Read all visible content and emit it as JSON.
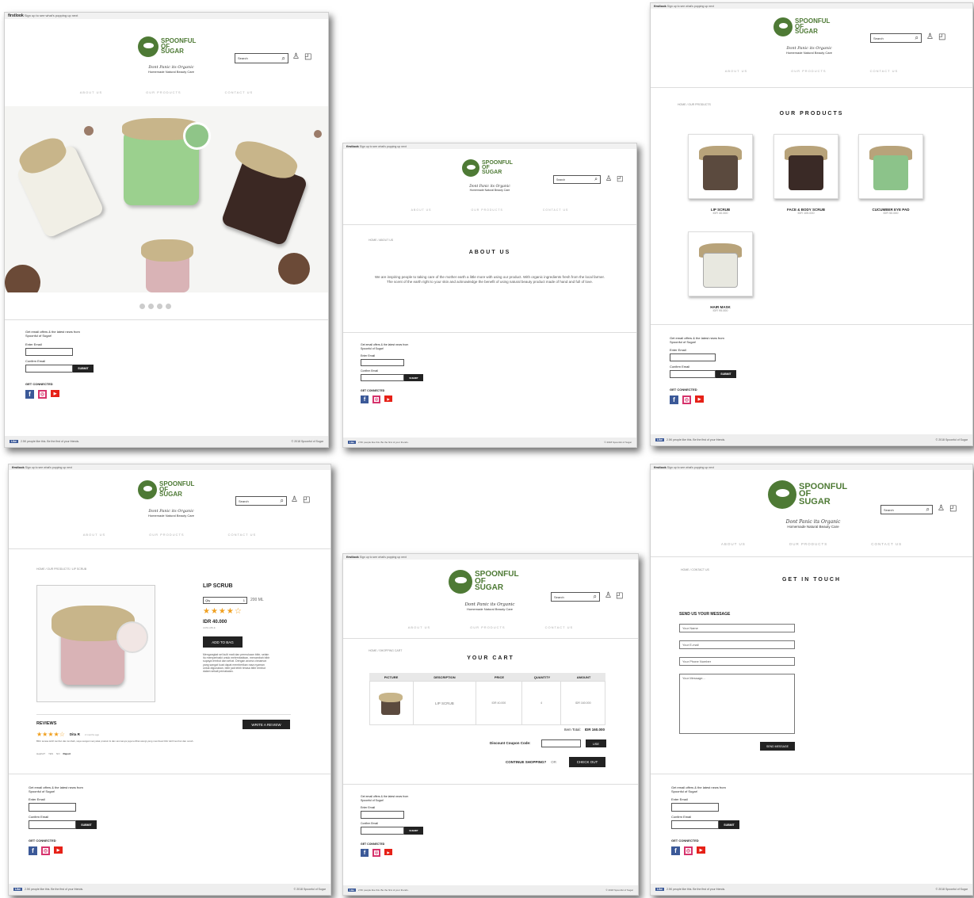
{
  "brand": {
    "name": [
      "SPOONFUL",
      "OF",
      "SUGAR"
    ],
    "slogan": "Dont Panic its Organic",
    "subtitle": "Homemade Natural Beauty Care",
    "color": "#4e7a35"
  },
  "topbar": {
    "brand": "firstlook",
    "text": "Sign up to see what's popping up next"
  },
  "search": {
    "placeholder": "Search"
  },
  "nav": {
    "about": "ABOUT US",
    "products": "OUR PRODUCTS",
    "contact": "CONTACT US"
  },
  "footer": {
    "offer": "Get email offers & the latest news from Spoonful of Sugar!",
    "enter_email": "Enter Email",
    "confirm_email": "Confirm Email",
    "submit": "SUBMIT",
    "connected": "GET CONNECTED",
    "like": "Like",
    "likes_text": "2.5K people like this. Be the first of your friends.",
    "copyright": "© 2018 Spoonful of Sugar"
  },
  "home": {
    "carousel_dots": 4
  },
  "about": {
    "crumb": "HOME / ABOUT US",
    "title": "ABOUT US",
    "body": "We are inspiring people to taking care of the mother earth a little more with using our product. With organic ingredients fresh from the local farmer. The scent of the earth right to your skin and acknowledge the benefit of using natural beauty product made of hand and full of love."
  },
  "products": {
    "crumb": "HOME / OUR PRODUCTS",
    "title": "OUR PRODUCTS",
    "items": [
      {
        "name": "LIP SCRUB",
        "price": "IDR 40.000",
        "color": "#5b4a3e"
      },
      {
        "name": "FACE & BODY SCRUB",
        "price": "IDR 105.000",
        "color": "#3a2a26"
      },
      {
        "name": "CUCUMBER EYE PAD",
        "price": "IDR 50.000",
        "color": "#8cc38a"
      },
      {
        "name": "HAIR MASK",
        "price": "IDR 95.000",
        "color": "#e8e8e0"
      }
    ]
  },
  "detail": {
    "crumb": "HOME / OUR PRODUCTS / LIP SCRUB",
    "name": "LIP SCRUB",
    "qty_label": "Qty",
    "qty": "1",
    "size": "200 ML",
    "rating": "★★★★☆",
    "price": "IDR 40.000",
    "stock": "AVAILABLE",
    "add": "ADD TO BAG",
    "desc": "Mengangkat sel kulit mati dan permukaan bibir, selain itu memperbaiki untuk melembabkan, menambah bibir supaya lembut dan sehat. Dengan aroma cinnamon yang sangat kuat dapat memberikan rasa nyaman untuk digunakan, bibir jadi lebih terasa bibir lembut dalam sekali pemakaian.",
    "reviews": "REVIEWS",
    "write": "WRITE A REVIEW",
    "reviewer": "Dita R",
    "review_stars": "★★★★☆",
    "review_time": "2 months ago",
    "review_text": "Bibir terasa lebih lembut dan lembab, saya sangat menyukai produk ini dan aromanya juga terlihat wangi yang membuat bibir lebih lembut dan cerah.",
    "helpful": "Helpful?",
    "yes": "YES",
    "no": "NO",
    "report": "Report"
  },
  "cart": {
    "crumb": "HOME / SHOPPING CART",
    "title": "YOUR CART",
    "headers": [
      "PICTURE",
      "DESCRIPTION",
      "PRICE",
      "QUANTITY",
      "AMOUNT"
    ],
    "row": {
      "desc": "LIP SCRUB",
      "price": "IDR 40.000",
      "qty": "4",
      "amount": "IDR 160.000"
    },
    "total_label": "Item Total:",
    "total": "IDR 160.000",
    "coupon": "Discount Coupon Code:",
    "use": "USE",
    "continue": "CONTINUE SHOPPING?",
    "or": "OR",
    "checkout": "CHECK OUT"
  },
  "contact": {
    "crumb": "HOME / CONTACT US",
    "title": "GET IN TOUCH",
    "form_title": "SEND US YOUR MESSAGE",
    "name": "Your Name",
    "email": "Your E-mail",
    "phone": "Your Phone Number",
    "message": "Your Message...",
    "send": "SEND MESSAGE"
  }
}
